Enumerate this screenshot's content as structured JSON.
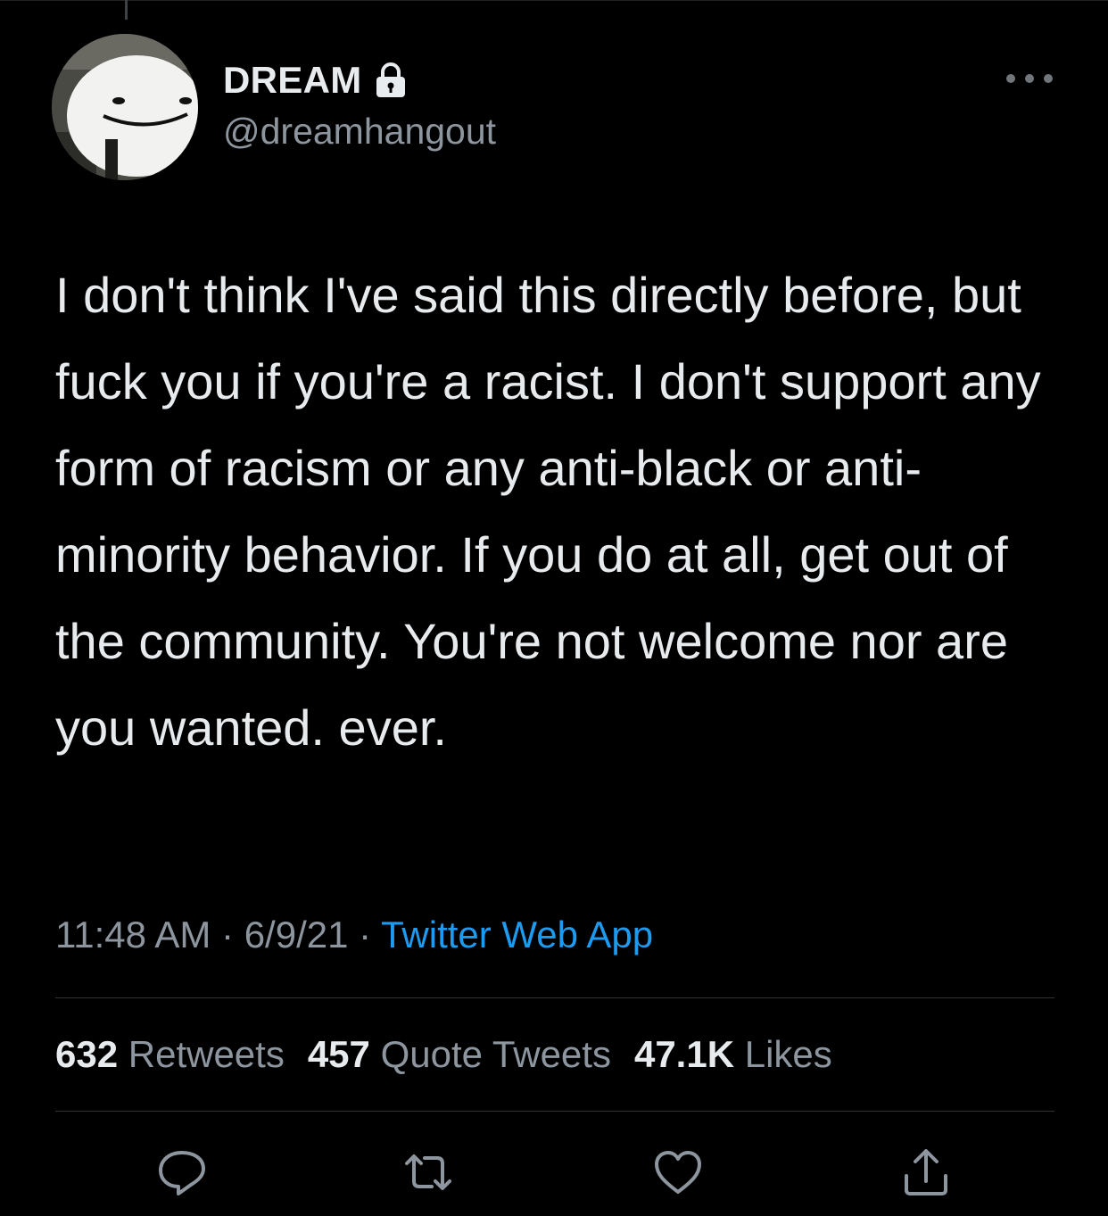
{
  "tweet": {
    "author_name": "DREAM",
    "handle": "@dreamhangout",
    "protected_icon": "lock-icon",
    "text": "I don't think I've said this directly before, but fuck you if you're a racist. I don't support any form of racism or any anti-black or anti-minority behavior. If you do at all, get out of the community. You're not welcome nor are you wanted. ever.",
    "time": "11:48 AM",
    "separator": "·",
    "date": "6/9/21",
    "source": "Twitter Web App"
  },
  "stats": {
    "retweets_count": "632",
    "retweets_label": "Retweets",
    "quotes_count": "457",
    "quotes_label": "Quote Tweets",
    "likes_count": "47.1K",
    "likes_label": "Likes"
  },
  "actions": [
    "reply-icon",
    "retweet-icon",
    "like-icon",
    "share-icon"
  ],
  "colors": {
    "background": "#000000",
    "text": "#e8ebed",
    "muted": "#8d969e",
    "link": "#1d9bf0",
    "divider": "#2f3336"
  }
}
